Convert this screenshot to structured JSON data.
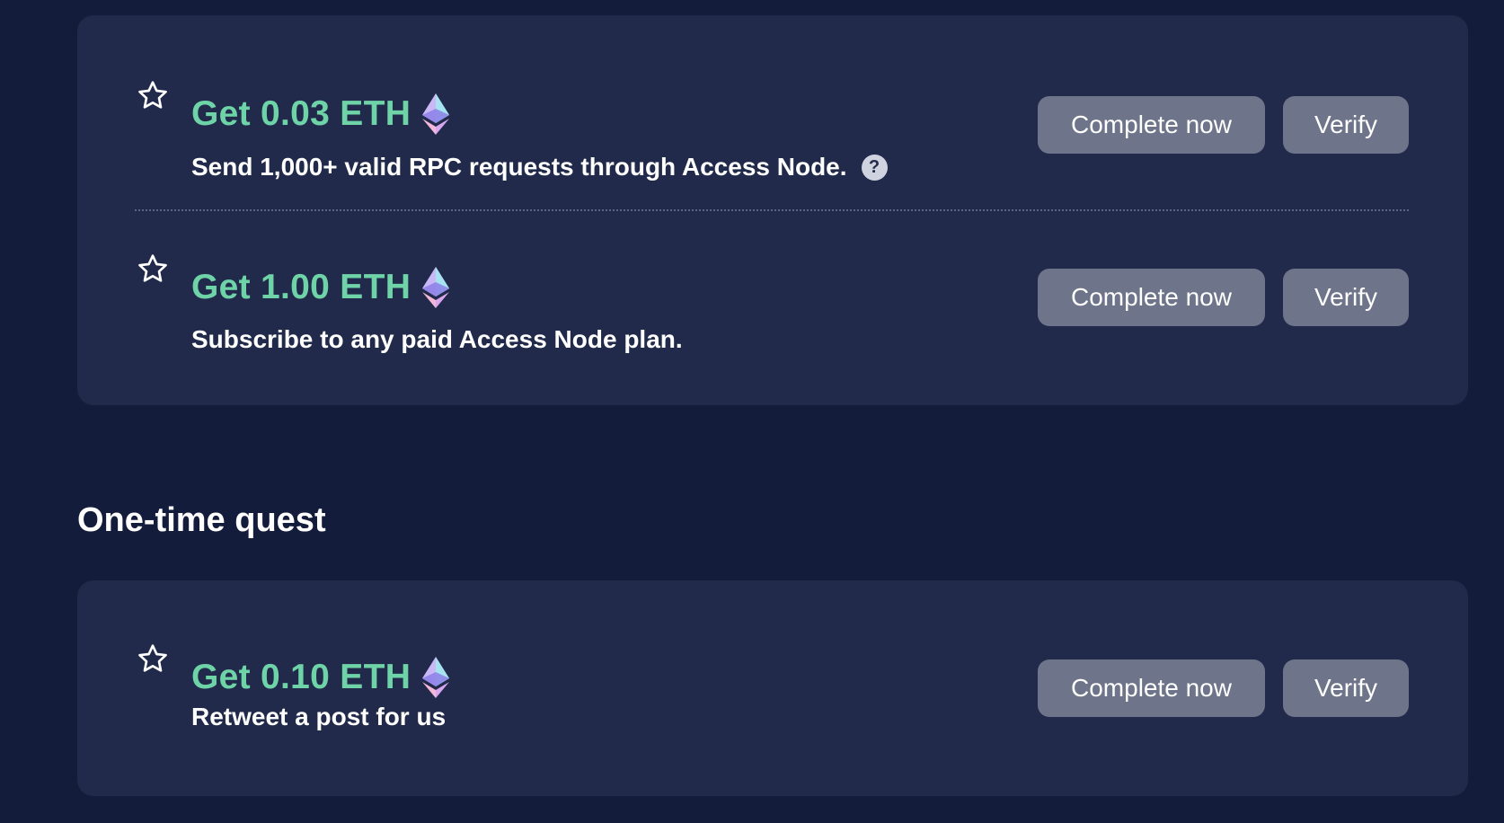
{
  "daily_card": {
    "quests": [
      {
        "reward": "Get 0.03 ETH",
        "description": "Send 1,000+ valid RPC requests through Access Node.",
        "help": "?",
        "complete_label": "Complete now",
        "verify_label": "Verify"
      },
      {
        "reward": "Get 1.00 ETH",
        "description": "Subscribe to any paid Access Node plan.",
        "complete_label": "Complete now",
        "verify_label": "Verify"
      }
    ]
  },
  "one_time_section": {
    "title": "One-time quest",
    "quests": [
      {
        "reward": "Get 0.10 ETH",
        "description": "Retweet a post for us",
        "complete_label": "Complete now",
        "verify_label": "Verify"
      }
    ]
  },
  "icons": {
    "star": "star-outline-icon",
    "eth": "ethereum-icon",
    "help": "question-circle-icon"
  },
  "colors": {
    "page_background": "#141c3b",
    "card_background": "#212a4a",
    "reward_text": "#6fd3a8",
    "button_background": "#6e7489",
    "help_icon_background": "#cfd3df"
  }
}
